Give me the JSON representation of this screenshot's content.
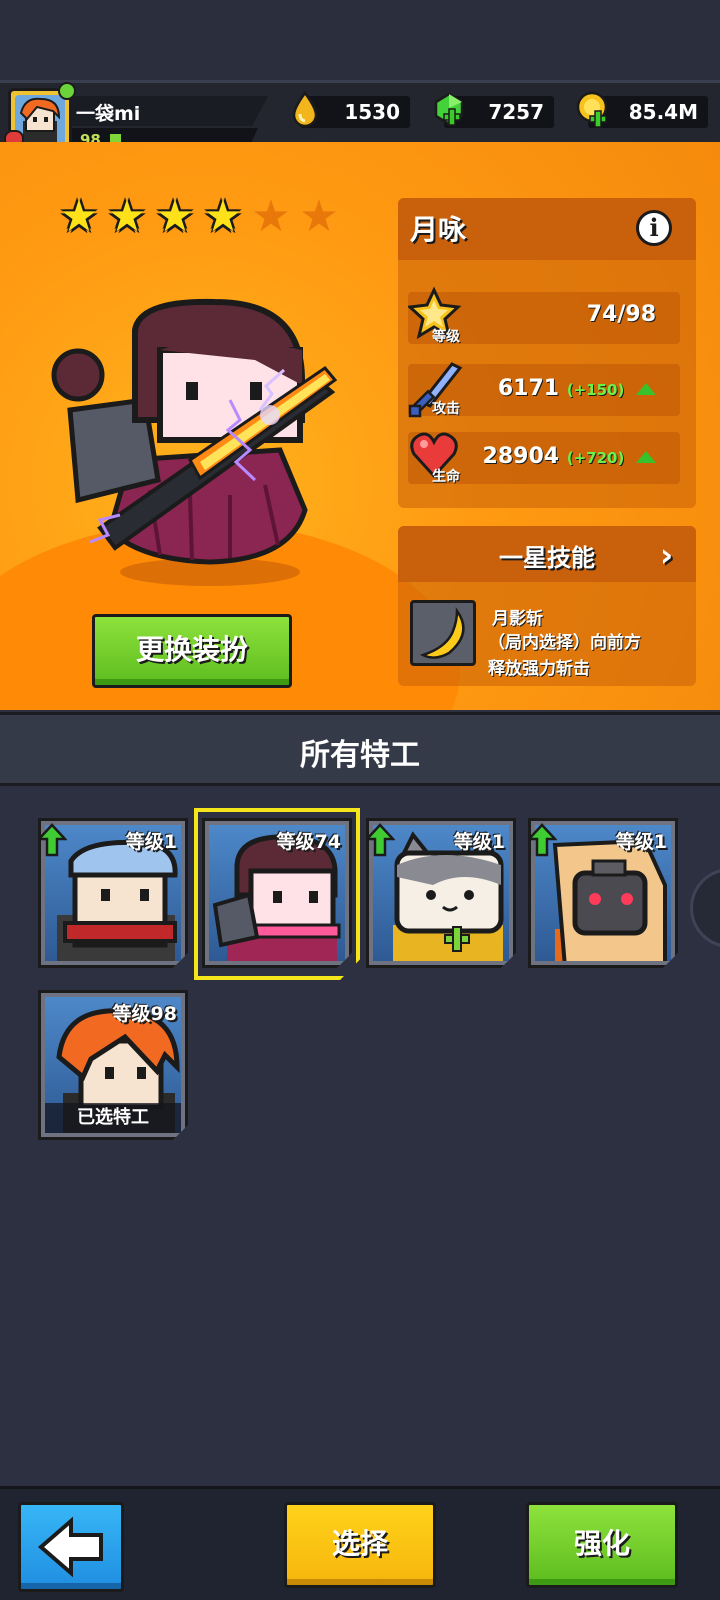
{
  "player": {
    "name": "一袋mi",
    "level": "98",
    "xp_progress": 0.08
  },
  "resources": [
    {
      "icon": "oil-drop-icon",
      "value": "1530"
    },
    {
      "icon": "green-gem-icon",
      "value": "7257"
    },
    {
      "icon": "gold-coin-icon",
      "value": "85.4M"
    }
  ],
  "hero": {
    "stars_total": 6,
    "stars_filled": 4,
    "agent_name": "月咏",
    "stats": {
      "level_label": "等级",
      "level_value": "74/98",
      "attack_label": "攻击",
      "attack_value": "6171",
      "attack_bonus": "(+150)",
      "hp_label": "生命",
      "hp_value": "28904",
      "hp_bonus": "(+720)"
    },
    "skill": {
      "header": "一星技能",
      "name": "月影斩",
      "description_line1": "（局内选择）向前方",
      "description_line2": "释放强力斩击"
    },
    "change_outfit_label": "更换装扮"
  },
  "roster": {
    "title": "所有特工",
    "cards": [
      {
        "level": "等级1",
        "upgradable": true,
        "selected_view": false,
        "in_use": false
      },
      {
        "level": "等级74",
        "upgradable": false,
        "selected_view": true,
        "in_use": false
      },
      {
        "level": "等级1",
        "upgradable": true,
        "selected_view": false,
        "in_use": false
      },
      {
        "level": "等级1",
        "upgradable": true,
        "selected_view": false,
        "in_use": false
      },
      {
        "level": "等级98",
        "upgradable": false,
        "selected_view": false,
        "in_use": true,
        "tag": "已选特工"
      }
    ]
  },
  "bottom": {
    "select_label": "选择",
    "upgrade_label": "强化"
  },
  "colors": {
    "hero_bg": "#ff9a12",
    "star_on": "#ffe11a",
    "button_green": "#6ccc24",
    "button_yellow": "#ffc612",
    "button_blue": "#2aa2ee",
    "bonus_green": "#6df04a",
    "selection_frame": "#f5e51b"
  }
}
